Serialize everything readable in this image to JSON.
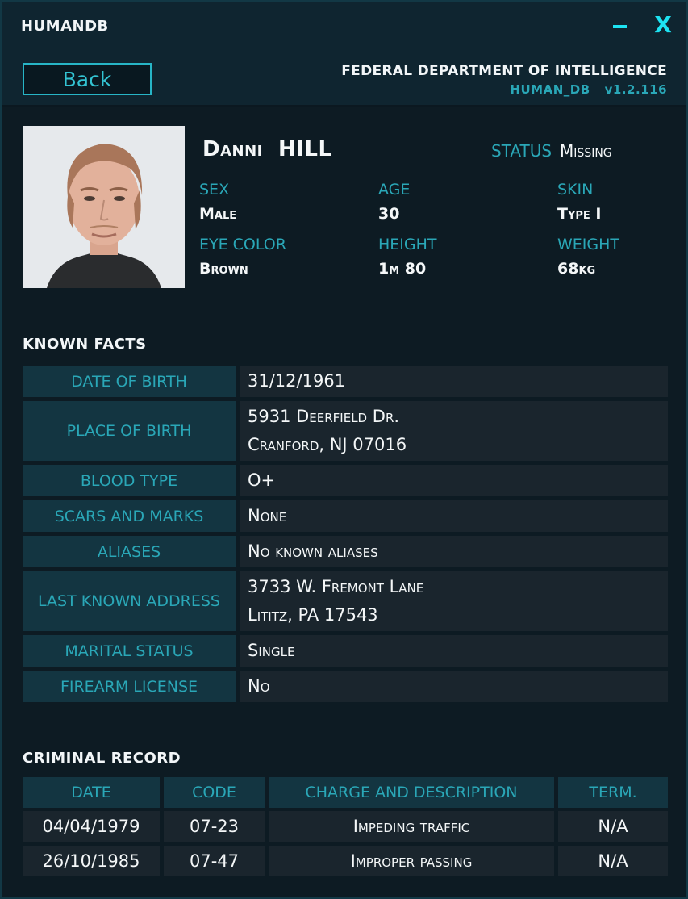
{
  "window": {
    "title": "HUMANDB",
    "min_icon": "minimize-icon",
    "close_label": "X"
  },
  "header": {
    "back_label": "Back",
    "agency": "FEDERAL DEPARTMENT OF INTELLIGENCE",
    "db_name": "HUMAN_DB",
    "version": "v1.2.116"
  },
  "profile": {
    "first_name": "Danni",
    "last_name": "HILL",
    "status_label": "STATUS",
    "status_value": "Missing",
    "sex_label": "SEX",
    "sex_value": "Male",
    "age_label": "AGE",
    "age_value": "30",
    "skin_label": "SKIN",
    "skin_value": "Type I",
    "eye_label": "EYE COLOR",
    "eye_value": "Brown",
    "height_label": "HEIGHT",
    "height_value": "1m 80",
    "weight_label": "WEIGHT",
    "weight_value": "68kg"
  },
  "facts": {
    "title": "KNOWN  FACTS",
    "rows": [
      {
        "label": "DATE OF BIRTH",
        "line1": "31/12/1961",
        "line2": ""
      },
      {
        "label": "PLACE OF BIRTH",
        "line1": "5931 Deerfield Dr.",
        "line2": "Cranford, NJ 07016"
      },
      {
        "label": "BLOOD TYPE",
        "line1": "O+",
        "line2": ""
      },
      {
        "label": "SCARS AND MARKS",
        "line1": "None",
        "line2": ""
      },
      {
        "label": "ALIASES",
        "line1": "No known aliases",
        "line2": ""
      },
      {
        "label": "LAST KNOWN ADDRESS",
        "line1": "3733 W. Fremont Lane",
        "line2": "Lititz, PA 17543"
      },
      {
        "label": "MARITAL STATUS",
        "line1": "Single",
        "line2": ""
      },
      {
        "label": "FIREARM LICENSE",
        "line1": "No",
        "line2": ""
      }
    ]
  },
  "record": {
    "title": "CRIMINAL  RECORD",
    "headers": {
      "date": "DATE",
      "code": "CODE",
      "charge": "CHARGE AND DESCRIPTION",
      "term": "TERM."
    },
    "rows": [
      {
        "date": "04/04/1979",
        "code": "07-23",
        "charge": "Impeding traffic",
        "term": "N/A"
      },
      {
        "date": "26/10/1985",
        "code": "07-47",
        "charge": "Improper passing",
        "term": "N/A"
      }
    ]
  },
  "colors": {
    "accent": "#1de3f2",
    "label": "#2aa7b7",
    "label_bg": "#133541",
    "value_bg": "#1a252d"
  }
}
